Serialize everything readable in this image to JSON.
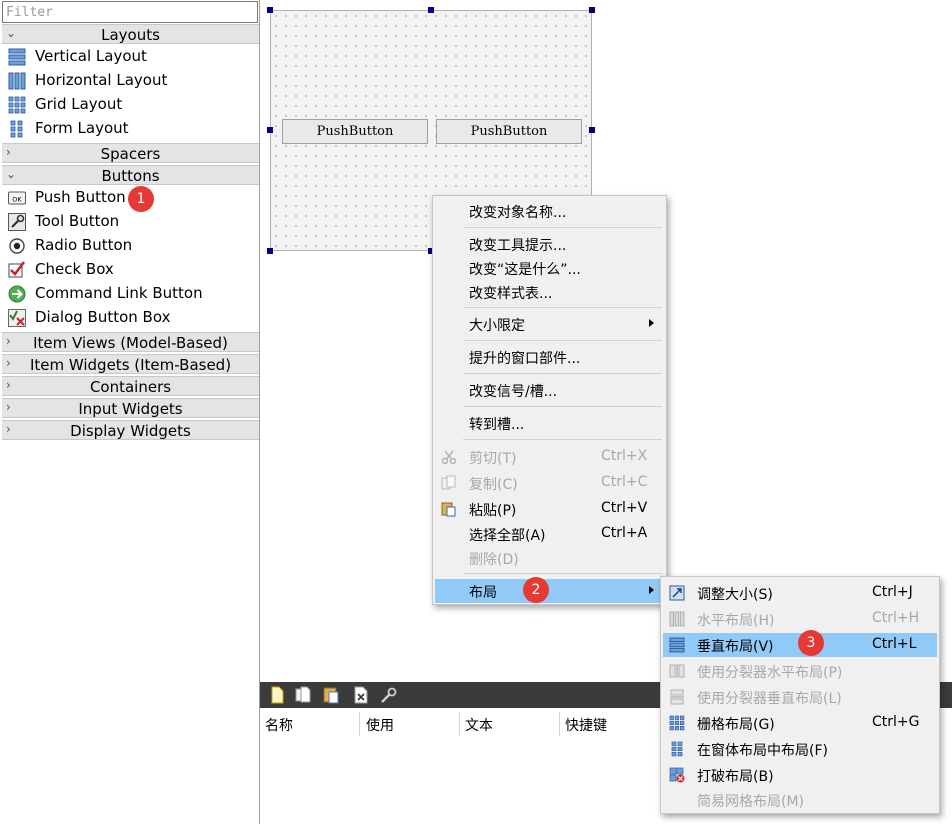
{
  "widget_box": {
    "filter_placeholder": "Filter",
    "categories": {
      "layouts": "Layouts",
      "spacers": "Spacers",
      "buttons": "Buttons",
      "item_views": "Item Views (Model-Based)",
      "item_widgets": "Item Widgets (Item-Based)",
      "containers": "Containers",
      "input_widgets": "Input Widgets",
      "display_widgets": "Display Widgets"
    },
    "layout_items": [
      "Vertical Layout",
      "Horizontal Layout",
      "Grid Layout",
      "Form Layout"
    ],
    "button_items": [
      "Push Button",
      "Tool Button",
      "Radio Button",
      "Check Box",
      "Command Link Button",
      "Dialog Button Box"
    ],
    "push_button_icon_text": "OK"
  },
  "form": {
    "buttons": [
      "PushButton",
      "PushButton"
    ]
  },
  "badges": [
    "1",
    "2",
    "3"
  ],
  "context_menu": {
    "items": [
      {
        "label": "改变对象名称..."
      },
      {
        "label": "改变工具提示..."
      },
      {
        "label": "改变“这是什么”..."
      },
      {
        "label": "改变样式表..."
      },
      {
        "label": "大小限定"
      },
      {
        "label": "提升的窗口部件..."
      },
      {
        "label": "改变信号/槽..."
      },
      {
        "label": "转到槽..."
      },
      {
        "label": "剪切(T)",
        "shortcut": "Ctrl+X"
      },
      {
        "label": "复制(C)",
        "shortcut": "Ctrl+C"
      },
      {
        "label": "粘贴(P)",
        "shortcut": "Ctrl+V"
      },
      {
        "label": "选择全部(A)",
        "shortcut": "Ctrl+A"
      },
      {
        "label": "删除(D)"
      },
      {
        "label": "布局"
      }
    ]
  },
  "layout_submenu": {
    "items": [
      {
        "label": "调整大小(S)",
        "shortcut": "Ctrl+J"
      },
      {
        "label": "水平布局(H)",
        "shortcut": "Ctrl+H"
      },
      {
        "label": "垂直布局(V)",
        "shortcut": "Ctrl+L"
      },
      {
        "label": "使用分裂器水平布局(P)"
      },
      {
        "label": "使用分裂器垂直布局(L)"
      },
      {
        "label": "栅格布局(G)",
        "shortcut": "Ctrl+G"
      },
      {
        "label": "在窗体布局中布局(F)"
      },
      {
        "label": "打破布局(B)"
      },
      {
        "label": "简易网格布局(M)"
      }
    ]
  },
  "action_editor": {
    "columns": [
      "名称",
      "使用",
      "文本",
      "快捷键"
    ]
  },
  "colors": {
    "menu_highlight": "#91c9f7",
    "badge": "#e53935",
    "selection_handle": "#000080",
    "toolbar_bg": "#3b3b3b"
  }
}
